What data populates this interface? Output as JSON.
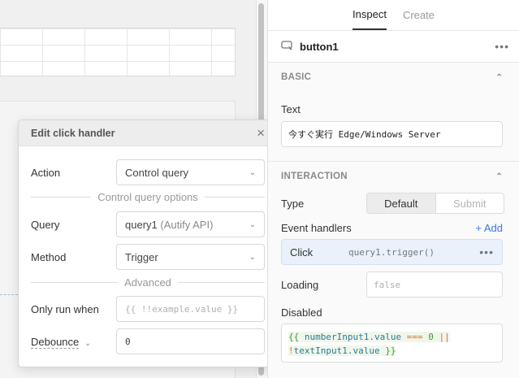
{
  "canvas": {},
  "modal": {
    "title": "Edit click handler",
    "action_label": "Action",
    "action_value": "Control query",
    "section_options": "Control query options",
    "query_label": "Query",
    "query_value": "query1",
    "query_source": "(Autify API)",
    "method_label": "Method",
    "method_value": "Trigger",
    "section_advanced": "Advanced",
    "only_run_label": "Only run when",
    "only_run_placeholder": "{{ !!example.value }}",
    "debounce_label": "Debounce",
    "debounce_value": "0"
  },
  "panel": {
    "tabs": [
      {
        "label": "Inspect",
        "active": true
      },
      {
        "label": "Create",
        "active": false
      }
    ],
    "component_name": "button1",
    "basic": {
      "heading": "BASIC",
      "text_label": "Text",
      "text_value": "今すぐ実行 Edge/Windows Server"
    },
    "interaction": {
      "heading": "INTERACTION",
      "type_label": "Type",
      "type_options": [
        "Default",
        "Submit"
      ],
      "event_handlers_label": "Event handlers",
      "add_label": "+ Add",
      "handler_event": "Click",
      "handler_action": "query1.trigger()",
      "loading_label": "Loading",
      "loading_placeholder": "false",
      "disabled_label": "Disabled",
      "disabled_code": {
        "open": "{{",
        "var1": "numberInput1.value",
        "op1": "===",
        "num": "0",
        "op2": "||",
        "not": "!",
        "var2": "textInput1.value",
        "close": "}}"
      }
    }
  }
}
